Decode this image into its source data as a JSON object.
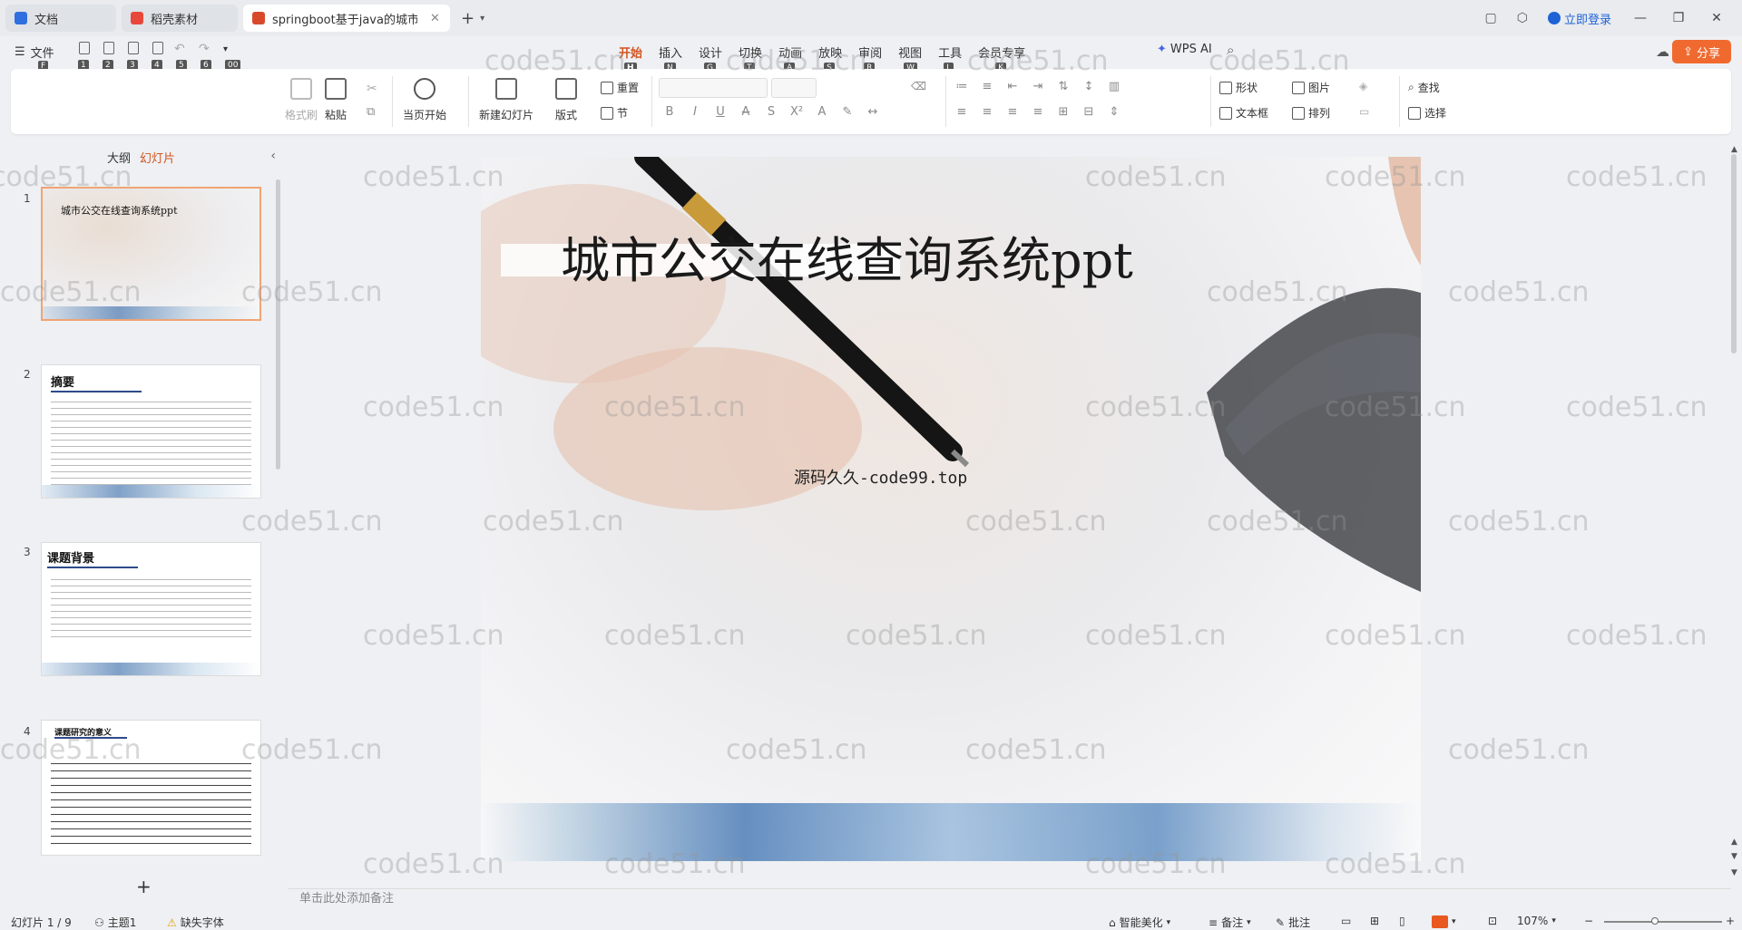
{
  "tabs": [
    {
      "label": "文档",
      "color": "#2f6fe0"
    },
    {
      "label": "稻壳素材",
      "color": "#e8473b"
    },
    {
      "label": "springboot基于java的城市…",
      "color": "#d64a2a"
    }
  ],
  "window": {
    "login_label": "立即登录",
    "share_label": "分享"
  },
  "menu": {
    "file_label": "文件",
    "quick_access_keytips": [
      "F",
      "1",
      "2",
      "3",
      "4",
      "5",
      "6",
      "00"
    ],
    "ribbon_tabs": [
      {
        "label": "开始",
        "key": "H"
      },
      {
        "label": "插入",
        "key": "N"
      },
      {
        "label": "设计",
        "key": "G"
      },
      {
        "label": "切换",
        "key": "T"
      },
      {
        "label": "动画",
        "key": "A"
      },
      {
        "label": "放映",
        "key": "S"
      },
      {
        "label": "审阅",
        "key": "R"
      },
      {
        "label": "视图",
        "key": "W"
      },
      {
        "label": "工具",
        "key": "L"
      },
      {
        "label": "会员专享",
        "key": "K"
      }
    ],
    "ai_label": "WPS AI"
  },
  "ribbon": {
    "format_painter": "格式刷",
    "paste": "粘贴",
    "play_from_current": "当页开始",
    "new_slide": "新建幻灯片",
    "layout": "版式",
    "reset": "重置",
    "section": "节",
    "shape": "形状",
    "picture": "图片",
    "textbox": "文本框",
    "arrange": "排列",
    "find": "查找",
    "select": "选择"
  },
  "left_pane": {
    "outline_tab": "大纲",
    "slides_tab": "幻灯片",
    "thumbnails": [
      {
        "num": "1",
        "title": "城市公交在线查询系统ppt"
      },
      {
        "num": "2",
        "title": "摘要"
      },
      {
        "num": "3",
        "title": "课题背景"
      },
      {
        "num": "4",
        "title": "课题研究的意义"
      }
    ],
    "add_slide": "+"
  },
  "slide": {
    "title": "城市公交在线查询系统ppt",
    "subtitle": "源码久久-code99.top"
  },
  "notes_placeholder": "单击此处添加备注",
  "status": {
    "slide_count": "幻灯片 1 / 9",
    "theme": "主题1",
    "missing_font": "缺失字体",
    "beautify": "智能美化",
    "notes": "备注",
    "comments": "批注",
    "zoom": "107%"
  },
  "watermark_text": "code51.cn"
}
